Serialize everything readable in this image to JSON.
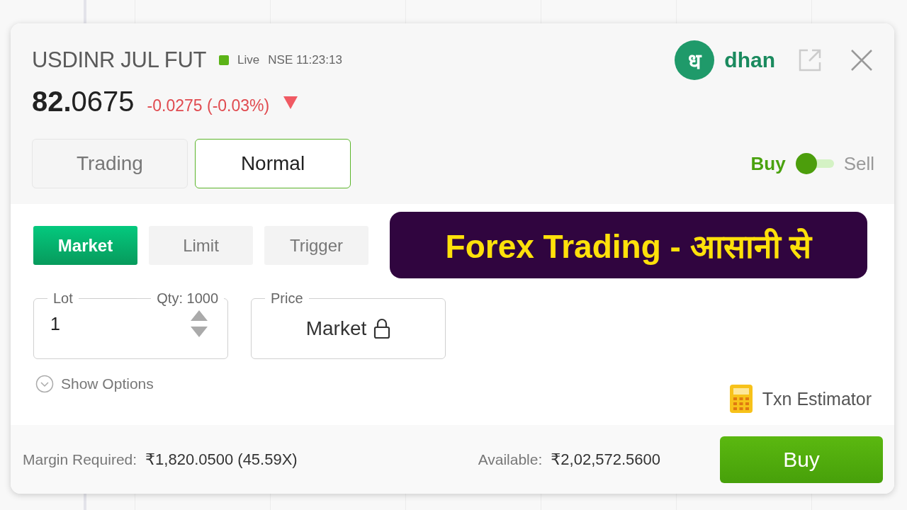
{
  "instrument": {
    "symbol": "USDINR JUL FUT",
    "live": true,
    "status": "Live",
    "exchange_time": "NSE 11:23:13",
    "price_int": "82.",
    "price_dec": "0675",
    "change": "-0.0275 (-0.03%)",
    "falling": true
  },
  "brand": {
    "glyph": "ध",
    "name": "dhan"
  },
  "product_tabs": [
    {
      "label": "Trading",
      "selected": false
    },
    {
      "label": "Normal",
      "selected": true
    }
  ],
  "side_toggle": {
    "buy_label": "Buy",
    "sell_label": "Sell",
    "buy_selected": true
  },
  "order_types": [
    {
      "label": "Market",
      "selected": true
    },
    {
      "label": "Limit",
      "selected": false
    },
    {
      "label": "Trigger",
      "selected": false
    }
  ],
  "banner": "Forex Trading - आसानी से",
  "lot_field": {
    "label": "Lot",
    "qty": "Qty: 1000",
    "value": "1"
  },
  "price_field": {
    "label": "Price",
    "value": "Market",
    "locked": true
  },
  "show_options": {
    "label": "Show Options",
    "expanded": false
  },
  "txn_estimator": "Txn Estimator",
  "footer": {
    "margin_label": "Margin Required:",
    "margin_value": "₹1,820.0500 (45.59X)",
    "available_label": "Available:",
    "available_value": "₹2,02,572.5600",
    "submit": "Buy"
  }
}
